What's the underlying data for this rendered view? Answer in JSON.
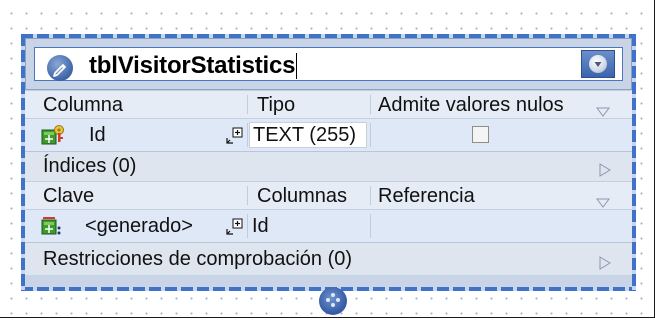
{
  "table": {
    "name": "tblVisitorStatistics"
  },
  "columns_section": {
    "headers": [
      "Columna",
      "Tipo",
      "Admite valores nulos"
    ],
    "rows": [
      {
        "name": "Id",
        "type": "TEXT (255)",
        "nullable": false
      }
    ]
  },
  "indexes_section": {
    "label": "Índices (0)"
  },
  "keys_section": {
    "headers": [
      "Clave",
      "Columnas",
      "Referencia"
    ],
    "rows": [
      {
        "name": "<generado>",
        "columns": "Id",
        "reference": ""
      }
    ]
  },
  "checks_section": {
    "label": "Restricciones de comprobación (0)"
  },
  "icons": {
    "edit": "pencil-icon",
    "menu": "dropdown-icon",
    "column": "primary-key-column-icon",
    "key": "primary-key-icon",
    "add": "add-item-icon",
    "expand": "expand-triangle-icon",
    "collapse": "collapse-triangle-icon",
    "resize": "resize-grip-icon"
  },
  "colors": {
    "selection_border": "#3f72c8",
    "header_bg": "#e6ecf5",
    "row_bg": "#dfe8f6",
    "title_bg": "#c9d5e6"
  }
}
